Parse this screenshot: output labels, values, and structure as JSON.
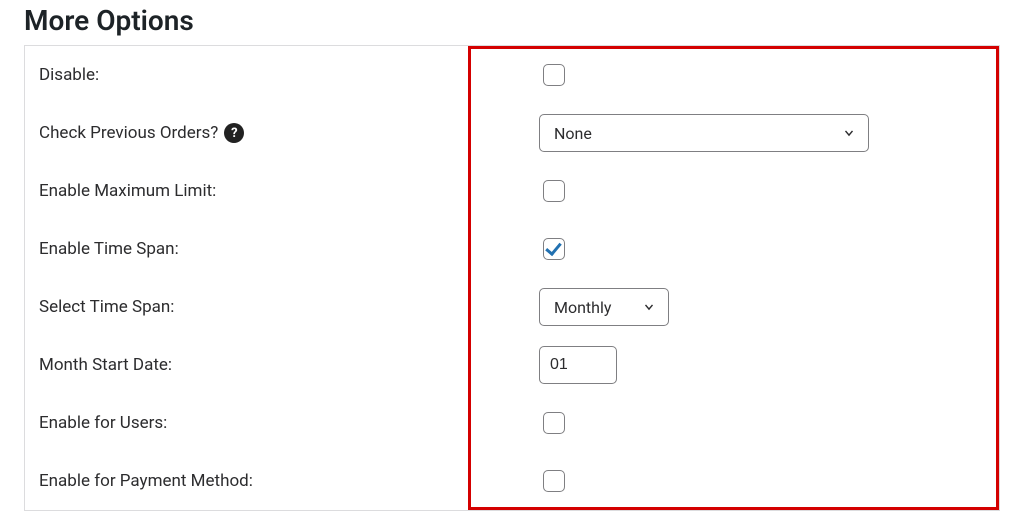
{
  "section": {
    "title": "More Options"
  },
  "labels": {
    "disable": "Disable:",
    "check_previous_orders": "Check Previous Orders?",
    "enable_max_limit": "Enable Maximum Limit:",
    "enable_time_span": "Enable Time Span:",
    "select_time_span": "Select Time Span:",
    "month_start_date": "Month Start Date:",
    "enable_for_users": "Enable for Users:",
    "enable_for_payment_method": "Enable for Payment Method:"
  },
  "values": {
    "disable_checked": false,
    "check_previous_orders_selected": "None",
    "enable_max_limit_checked": false,
    "enable_time_span_checked": true,
    "select_time_span_selected": "Monthly",
    "month_start_date": "01",
    "enable_for_users_checked": false,
    "enable_for_payment_method_checked": false
  },
  "icons": {
    "help_glyph": "?"
  },
  "colors": {
    "highlight_border": "#d40000",
    "checkbox_check": "#2271b1"
  }
}
